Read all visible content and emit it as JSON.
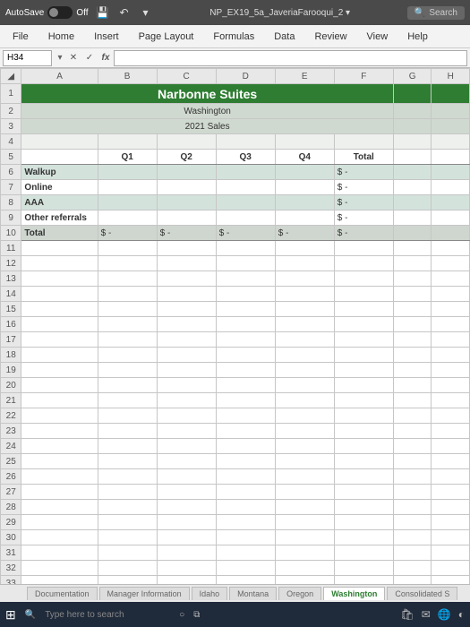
{
  "titlebar": {
    "autosave_label": "AutoSave",
    "autosave_state": "Off",
    "filename": "NP_EX19_5a_JaveriaFarooqui_2",
    "search_placeholder": "Search"
  },
  "ribbon": {
    "tabs": [
      "File",
      "Home",
      "Insert",
      "Page Layout",
      "Formulas",
      "Data",
      "Review",
      "View",
      "Help"
    ]
  },
  "formulabar": {
    "namebox": "H34",
    "cancel": "✕",
    "enter": "✓",
    "fx": "fx"
  },
  "columns": [
    "A",
    "B",
    "C",
    "D",
    "E",
    "F",
    "G",
    "H"
  ],
  "sheet": {
    "title": "Narbonne Suites",
    "subtitle1": "Washington",
    "subtitle2": "2021 Sales",
    "headers": {
      "q1": "Q1",
      "q2": "Q2",
      "q3": "Q3",
      "q4": "Q4",
      "total": "Total"
    },
    "rows": {
      "walkup": {
        "label": "Walkup",
        "total_sym": "$",
        "total_val": "-"
      },
      "online": {
        "label": "Online",
        "total_sym": "$",
        "total_val": "-"
      },
      "aaa": {
        "label": "AAA",
        "total_sym": "$",
        "total_val": "-"
      },
      "other": {
        "label": "Other referrals",
        "total_sym": "$",
        "total_val": "-"
      },
      "total": {
        "label": "Total",
        "q1_sym": "$",
        "q1_val": "-",
        "q2_sym": "$",
        "q2_val": "-",
        "q3_sym": "$",
        "q3_val": "-",
        "q4_sym": "$",
        "q4_val": "-",
        "total_sym": "$",
        "total_val": "-"
      }
    }
  },
  "sheettabs": [
    "Documentation",
    "Manager Information",
    "Idaho",
    "Montana",
    "Oregon",
    "Washington",
    "Consolidated S"
  ],
  "sheettab_active": "Washington",
  "taskbar": {
    "search_placeholder": "Type here to search"
  }
}
